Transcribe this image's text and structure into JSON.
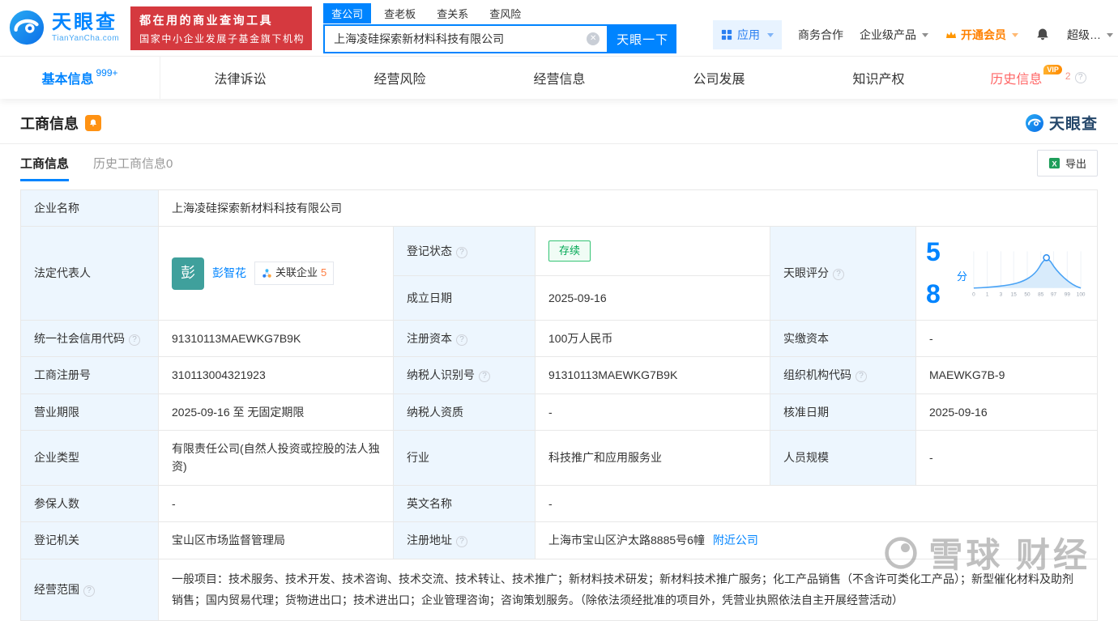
{
  "colors": {
    "brand_blue": "#0084ff",
    "banner_red": "#d5393f",
    "vip_orange": "#ff8000",
    "status_green": "#00a854",
    "history_tab_red": "#ff6655",
    "label_cell_bg": "#edf6fe",
    "score_blue": "#0084ff"
  },
  "header": {
    "logo": {
      "name_cn": "天眼查",
      "name_en": "TianYanCha.com"
    },
    "banner": {
      "line1": "都在用的商业查询工具",
      "line2": "国家中小企业发展子基金旗下机构"
    },
    "search": {
      "tabs": [
        "查公司",
        "查老板",
        "查关系",
        "查风险"
      ],
      "active_tab": "查公司",
      "value": "上海凌硅探索新材料科技有限公司",
      "button_label": "天眼一下"
    },
    "menu": {
      "apps": "应用",
      "cooperation": "商务合作",
      "enterprise_products": "企业级产品",
      "vip": "开通会员",
      "super": "超级…"
    }
  },
  "nav": {
    "tabs": [
      {
        "label": "基本信息",
        "badge": "999+"
      },
      {
        "label": "法律诉讼"
      },
      {
        "label": "经营风险"
      },
      {
        "label": "经营信息"
      },
      {
        "label": "公司发展"
      },
      {
        "label": "知识产权"
      },
      {
        "label": "历史信息",
        "badge": "VIP",
        "count": "2"
      }
    ]
  },
  "section": {
    "title": "工商信息",
    "brand": "天眼查",
    "subtabs": [
      {
        "label": "工商信息"
      },
      {
        "label": "历史工商信息0"
      }
    ],
    "export_label": "导出"
  },
  "business_info": {
    "company_name": {
      "label": "企业名称",
      "value": "上海凌硅探索新材料科技有限公司"
    },
    "legal_rep": {
      "label": "法定代表人",
      "avatar": "彭",
      "name": "彭智花",
      "related_label": "关联企业",
      "related_count": "5"
    },
    "reg_status": {
      "label": "登记状态",
      "value": "存续"
    },
    "establish_date": {
      "label": "成立日期",
      "value": "2025-09-16"
    },
    "score": {
      "label": "天眼评分",
      "value": "58",
      "unit": "分",
      "axis_ticks": [
        "0",
        "1",
        "3",
        "15",
        "50",
        "85",
        "97",
        "99",
        "100"
      ]
    },
    "credit_code": {
      "label": "统一社会信用代码",
      "value": "91310113MAEWKG7B9K"
    },
    "reg_capital": {
      "label": "注册资本",
      "value": "100万人民币"
    },
    "paid_capital": {
      "label": "实缴资本",
      "value": "-"
    },
    "reg_number": {
      "label": "工商注册号",
      "value": "310113004321923"
    },
    "taxpayer_id": {
      "label": "纳税人识别号",
      "value": "91310113MAEWKG7B9K"
    },
    "org_code": {
      "label": "组织机构代码",
      "value": "MAEWKG7B-9"
    },
    "business_term": {
      "label": "营业期限",
      "value": "2025-09-16 至 无固定期限"
    },
    "taxpayer_qualification": {
      "label": "纳税人资质",
      "value": "-"
    },
    "approval_date": {
      "label": "核准日期",
      "value": "2025-09-16"
    },
    "company_type": {
      "label": "企业类型",
      "value": "有限责任公司(自然人投资或控股的法人独资)"
    },
    "industry": {
      "label": "行业",
      "value": "科技推广和应用服务业"
    },
    "staff_size": {
      "label": "人员规模",
      "value": "-"
    },
    "insured_count": {
      "label": "参保人数",
      "value": "-"
    },
    "english_name": {
      "label": "英文名称",
      "value": "-"
    },
    "registration_authority": {
      "label": "登记机关",
      "value": "宝山区市场监督管理局"
    },
    "registered_address": {
      "label": "注册地址",
      "value": "上海市宝山区沪太路8885号6幢",
      "link_label": "附近公司"
    },
    "business_scope": {
      "label": "经营范围",
      "value": "一般项目：技术服务、技术开发、技术咨询、技术交流、技术转让、技术推广；新材料技术研发；新材料技术推广服务；化工产品销售（不含许可类化工产品）；新型催化材料及助剂销售；国内贸易代理；货物进出口；技术进出口；企业管理咨询；咨询策划服务。（除依法须经批准的项目外，凭营业执照依法自主开展经营活动）"
    }
  },
  "watermark": {
    "text": "雪球 财经"
  }
}
